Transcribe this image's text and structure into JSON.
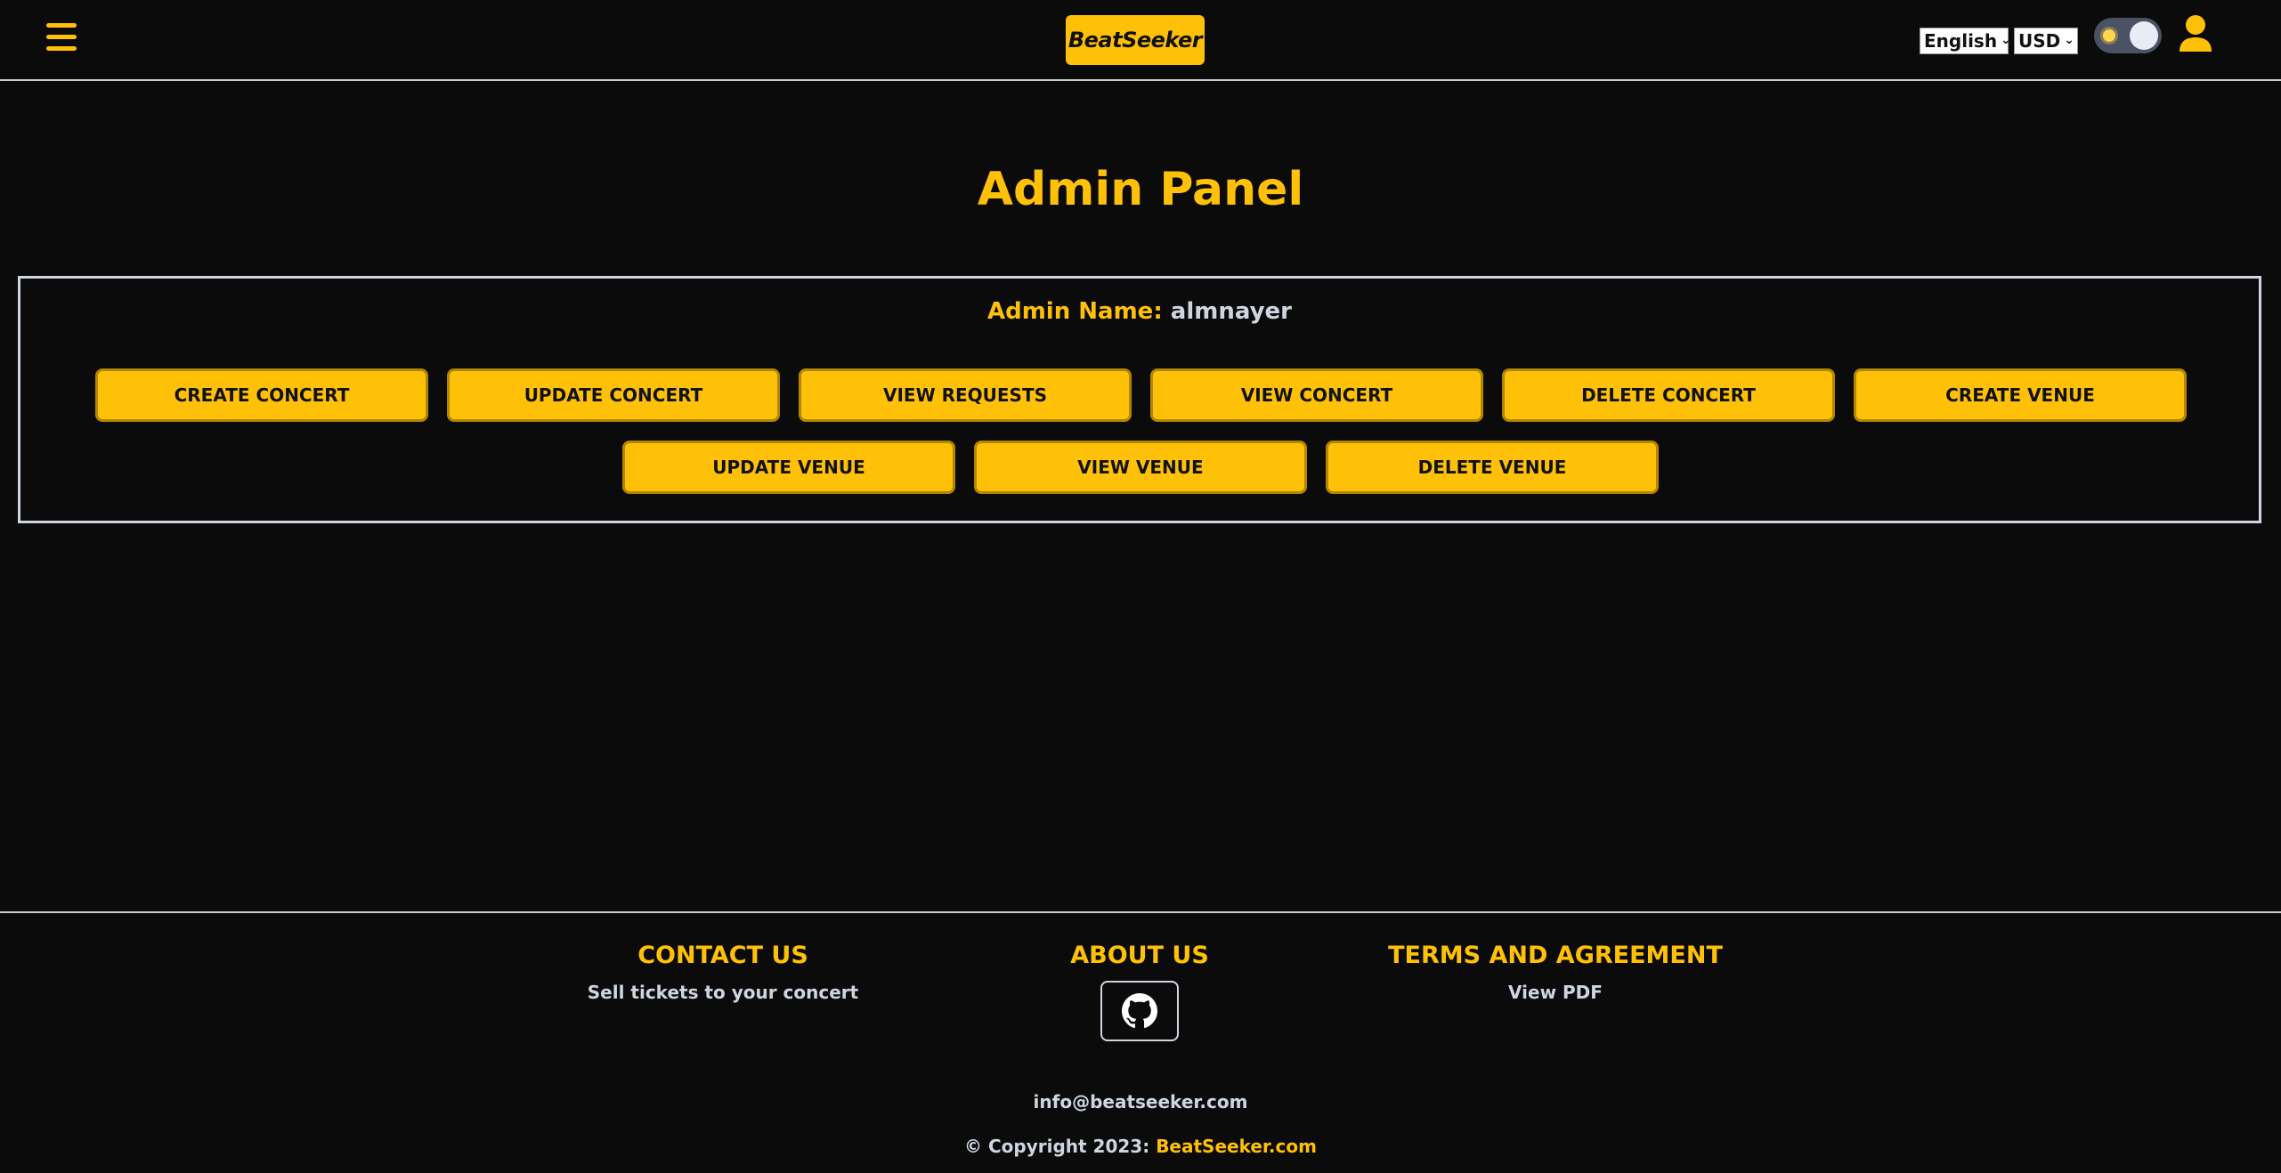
{
  "header": {
    "menu_icon": "hamburger-menu-icon",
    "logo_text": "BeatSeeker",
    "language": {
      "selected": "English"
    },
    "currency": {
      "selected": "USD"
    },
    "theme_toggle_icon": "sun-icon",
    "user_icon": "user-icon"
  },
  "main": {
    "title": "Admin Panel",
    "admin_name_label": "Admin Name:",
    "admin_name_value": "almnayer",
    "buttons": {
      "create_concert": "CREATE CONCERT",
      "update_concert": "UPDATE CONCERT",
      "view_requests": "VIEW REQUESTS",
      "view_concert": "VIEW CONCERT",
      "delete_concert": "DELETE CONCERT",
      "create_venue": "CREATE VENUE",
      "update_venue": "UPDATE VENUE",
      "view_venue": "VIEW VENUE",
      "delete_venue": "DELETE VENUE"
    }
  },
  "footer": {
    "contact_heading": "CONTACT US",
    "contact_link": "Sell tickets to your concert",
    "about_heading": "ABOUT US",
    "about_icon": "github-icon",
    "terms_heading": "TERMS AND AGREEMENT",
    "terms_link": "View PDF",
    "email": "info@beatseeker.com",
    "copyright_prefix": "© Copyright 2023:",
    "copyright_brand": "BeatSeeker.com"
  },
  "colors": {
    "background": "#0b0b0b",
    "accent": "#ffc107",
    "text_muted": "#cfd6e2",
    "border": "#c8ccd4"
  }
}
